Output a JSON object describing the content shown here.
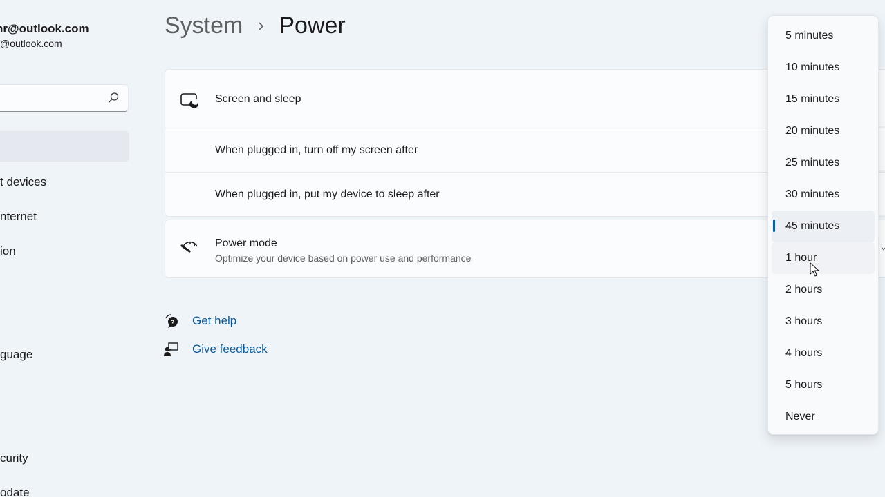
{
  "sidebar": {
    "account_name": "nr@outlook.com",
    "account_email": "@outlook.com",
    "search": {
      "placeholder": "",
      "icon": "search-icon"
    },
    "items": [
      {
        "label": "t devices"
      },
      {
        "label": "nternet"
      },
      {
        "label": "ion"
      },
      {
        "label": "guage"
      },
      {
        "label": "curity"
      },
      {
        "label": "odate"
      }
    ]
  },
  "header": {
    "breadcrumb_parent": "System",
    "breadcrumb_separator_icon": "chevron-right-icon",
    "page_title": "Power"
  },
  "screen_sleep": {
    "icon": "screen-sleep-icon",
    "title": "Screen and sleep",
    "rows": [
      {
        "label": "When plugged in, turn off my screen after"
      },
      {
        "label": "When plugged in, put my device to sleep after"
      }
    ]
  },
  "power_mode": {
    "icon": "speedometer-icon",
    "title": "Power mode",
    "subtitle": "Optimize your device based on power use and performance"
  },
  "help_links": [
    {
      "icon": "get-help-icon",
      "label": "Get help"
    },
    {
      "icon": "feedback-icon",
      "label": "Give feedback"
    }
  ],
  "timeout_dropdown": {
    "selected": "45 minutes",
    "hovered": "1 hour",
    "options": [
      "5 minutes",
      "10 minutes",
      "15 minutes",
      "20 minutes",
      "25 minutes",
      "30 minutes",
      "45 minutes",
      "1 hour",
      "2 hours",
      "3 hours",
      "4 hours",
      "5 hours",
      "Never"
    ],
    "accent_color": "#0a5ea8"
  }
}
